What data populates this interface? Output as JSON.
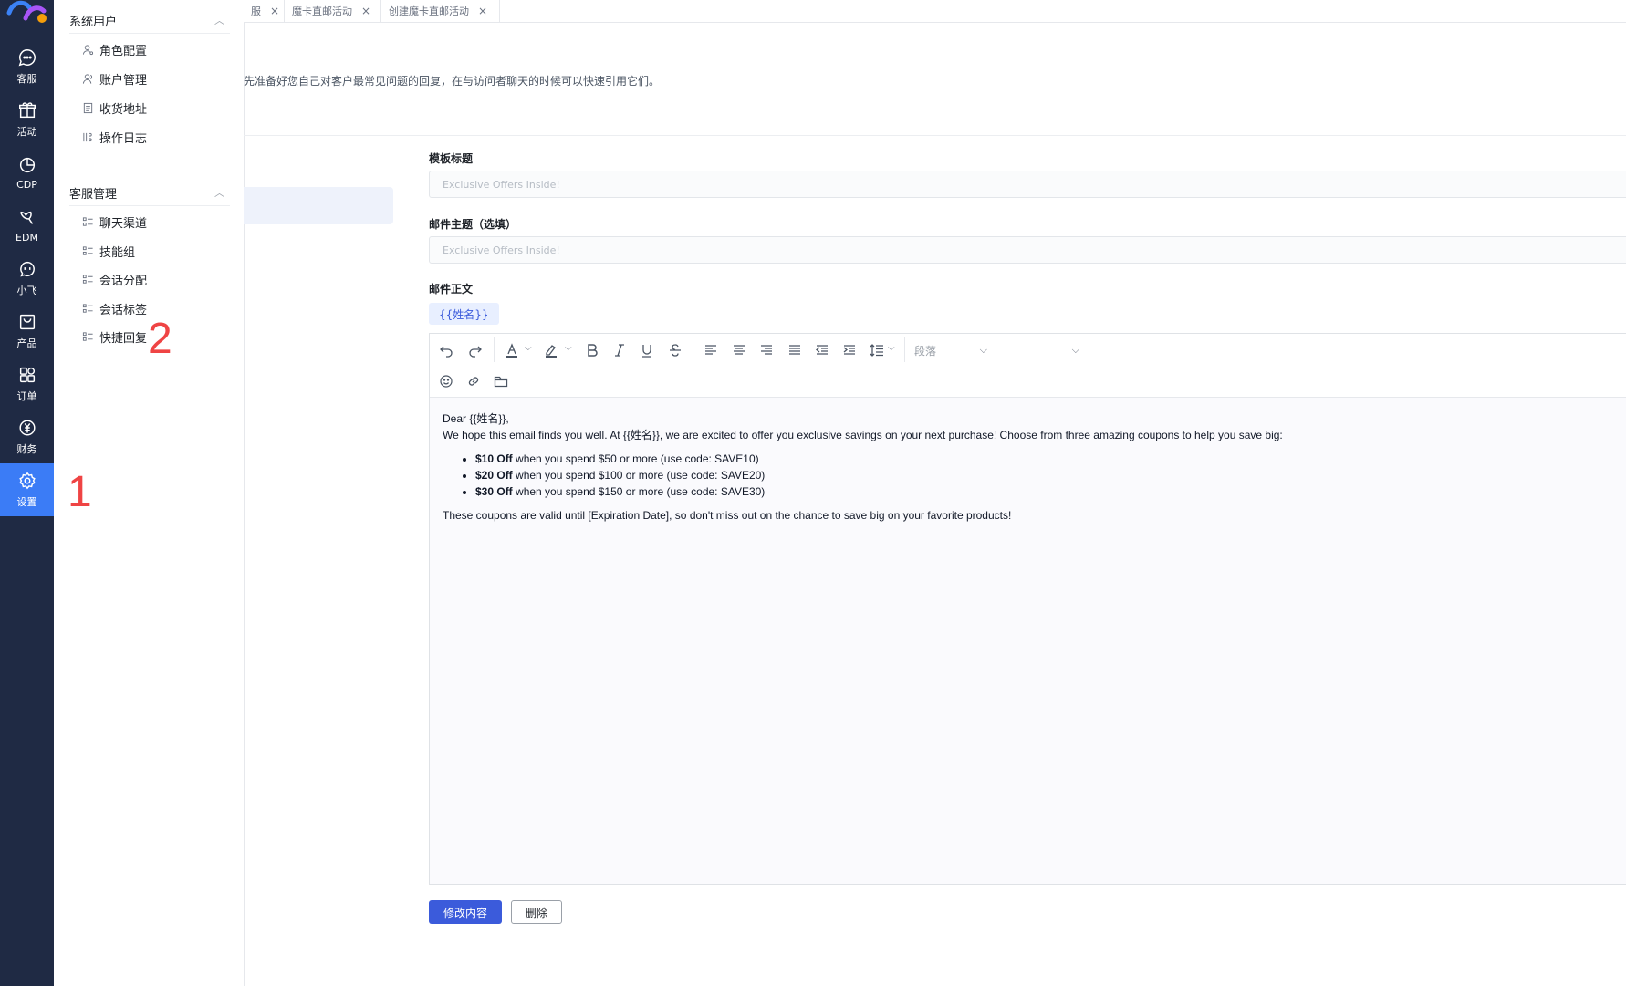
{
  "rail": {
    "items": [
      {
        "label": "客服",
        "icon": "chat-icon"
      },
      {
        "label": "活动",
        "icon": "gift-icon"
      },
      {
        "label": "CDP",
        "icon": "pie-chart-icon"
      },
      {
        "label": "EDM",
        "icon": "bird-icon"
      },
      {
        "label": "小飞",
        "icon": "bot-icon"
      },
      {
        "label": "产品",
        "icon": "bag-icon"
      },
      {
        "label": "订单",
        "icon": "grid-icon"
      },
      {
        "label": "财务",
        "icon": "yen-icon"
      },
      {
        "label": "设置",
        "icon": "gear-icon"
      }
    ],
    "active": "设置",
    "active_color": "#3b7cf6",
    "bg_color": "#1f2a44"
  },
  "menu": {
    "group1": {
      "title": "系统用户",
      "items": [
        "角色配置",
        "账户管理",
        "收货地址",
        "操作日志"
      ]
    },
    "group2": {
      "title": "客服管理",
      "items": [
        "聊天渠道",
        "技能组",
        "会话分配",
        "会话标签",
        "快捷回复"
      ]
    }
  },
  "annotations": {
    "one": "1",
    "two": "2"
  },
  "tabs": [
    {
      "label": "服"
    },
    {
      "label": "魔卡直邮活动"
    },
    {
      "label": "创建魔卡直邮活动"
    }
  ],
  "page": {
    "description": "先准备好您自己对客户最常见问题的回复，在与访问者聊天的时候可以快速引用它们。"
  },
  "form": {
    "template_title_label": "模板标题",
    "template_title_placeholder": "Exclusive Offers Inside!",
    "subject_label": "邮件主题（选填）",
    "subject_placeholder": "Exclusive Offers Inside!",
    "body_label": "邮件正文",
    "variable_tag": "{{姓名}}",
    "paragraph_select": "段落"
  },
  "email": {
    "greeting": "Dear {{姓名}},",
    "intro": "We hope this email finds you well. At {{姓名}}, we are excited to offer you exclusive savings on your next purchase! Choose from three amazing coupons to help you save big:",
    "coupons": [
      {
        "bold": "$10 Off",
        "rest": " when you spend $50 or more (use code: SAVE10)"
      },
      {
        "bold": "$20 Off",
        "rest": " when you spend $100 or more (use code: SAVE20)"
      },
      {
        "bold": "$30 Off",
        "rest": " when you spend $150 or more (use code: SAVE30)"
      }
    ],
    "closing": "These coupons are valid until [Expiration Date], so don't miss out on the chance to save big on your favorite products!"
  },
  "actions": {
    "save_label": "修改内容",
    "delete_label": "删除",
    "primary_color": "#3b5bdb"
  }
}
